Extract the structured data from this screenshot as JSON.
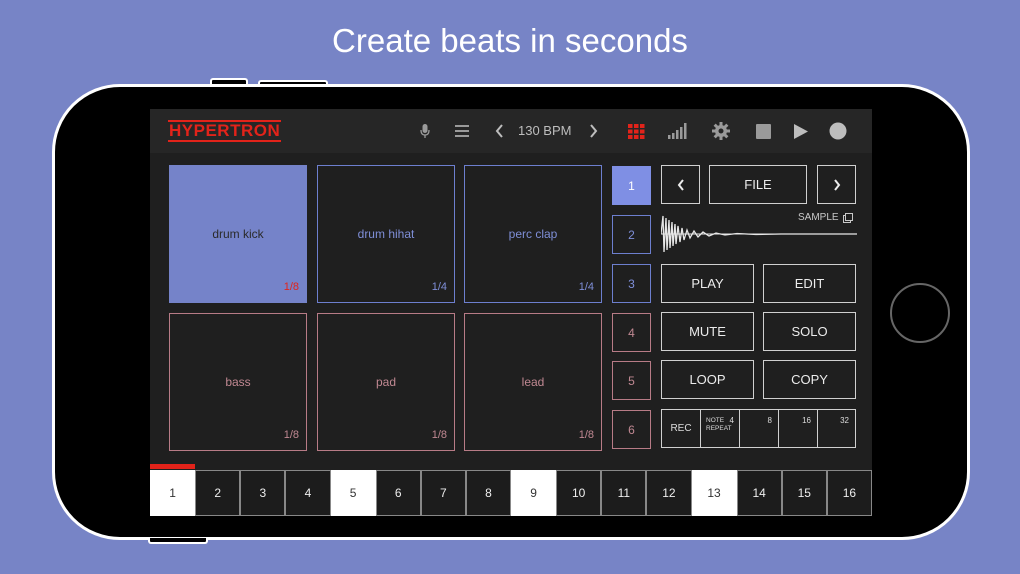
{
  "headline": "Create beats in seconds",
  "app": {
    "logo": "HYPERTRON",
    "bpm": "130 BPM"
  },
  "icons": [
    "mic-icon",
    "menu-icon",
    "chevron-left-icon",
    "chevron-right-icon",
    "grid-icon",
    "signal-icon",
    "gear-icon",
    "stop-icon",
    "play-icon",
    "record-icon"
  ],
  "pads": [
    {
      "name": "drum kick",
      "frac": "1/8",
      "active": true
    },
    {
      "name": "drum hihat",
      "frac": "1/4"
    },
    {
      "name": "perc clap",
      "frac": "1/4"
    },
    {
      "name": "bass",
      "frac": "1/8"
    },
    {
      "name": "pad",
      "frac": "1/8"
    },
    {
      "name": "lead",
      "frac": "1/8"
    }
  ],
  "banks": [
    "1",
    "2",
    "3",
    "4",
    "5",
    "6"
  ],
  "file": {
    "label": "FILE",
    "prev": "‹",
    "next": "›"
  },
  "sample": {
    "label": "SAMPLE"
  },
  "buttons": {
    "play": "PLAY",
    "edit": "EDIT",
    "mute": "MUTE",
    "solo": "SOLO",
    "loop": "LOOP",
    "copy": "COPY"
  },
  "rec": {
    "rec": "REC",
    "note": "NOTE",
    "repeat": "REPEAT",
    "v4": "4",
    "v8": "8",
    "v16": "16",
    "v32": "32"
  },
  "steps": [
    "1",
    "2",
    "3",
    "4",
    "5",
    "6",
    "7",
    "8",
    "9",
    "10",
    "11",
    "12",
    "13",
    "14",
    "15",
    "16"
  ],
  "colors": {
    "background": "#7784c6",
    "accent_red": "#e2231a",
    "pad_active": "#7583c9",
    "bank_active": "#7f8fe4"
  }
}
